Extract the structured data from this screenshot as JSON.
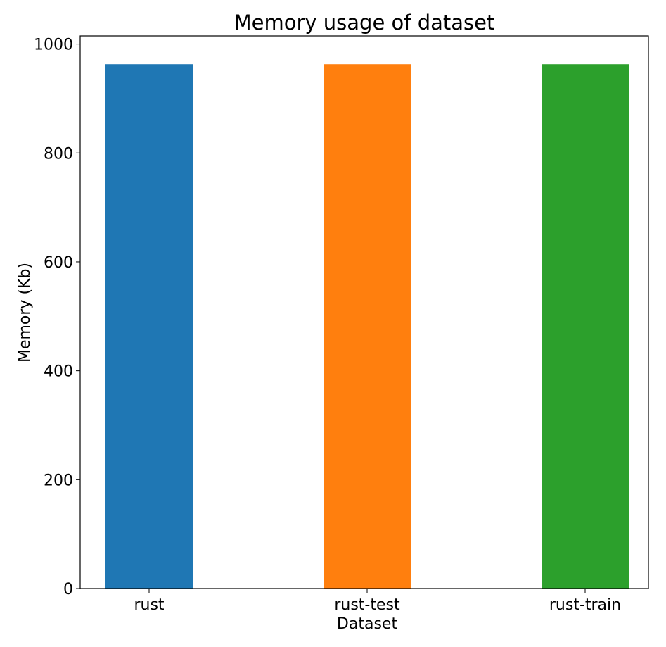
{
  "chart_data": {
    "type": "bar",
    "title": "Memory usage of dataset",
    "xlabel": "Dataset",
    "ylabel": "Memory (Kb)",
    "categories": [
      "rust",
      "rust-test",
      "rust-train"
    ],
    "values": [
      963,
      963,
      963
    ],
    "colors": [
      "#1f77b4",
      "#ff7f0e",
      "#2ca02c"
    ],
    "ylim": [
      0,
      1015
    ],
    "yticks": [
      0,
      200,
      400,
      600,
      800,
      1000
    ],
    "grid": false,
    "legend": "none"
  }
}
